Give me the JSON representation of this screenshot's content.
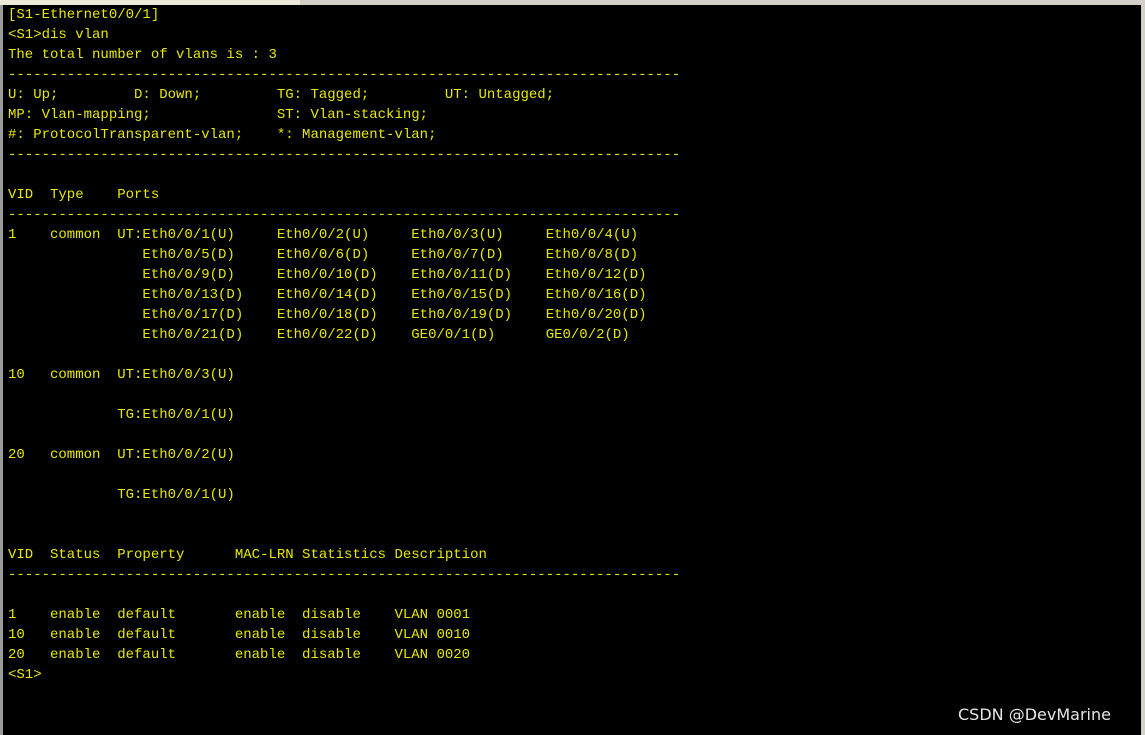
{
  "terminal": {
    "text_color": "#e8e800",
    "background": "#000000",
    "lines": [
      "[S1-Ethernet0/0/1]",
      "<S1>dis vlan",
      "The total number of vlans is : 3",
      "--------------------------------------------------------------------------------",
      "U: Up;         D: Down;         TG: Tagged;         UT: Untagged;",
      "MP: Vlan-mapping;               ST: Vlan-stacking;",
      "#: ProtocolTransparent-vlan;    *: Management-vlan;",
      "--------------------------------------------------------------------------------",
      "",
      "VID  Type    Ports",
      "--------------------------------------------------------------------------------",
      "1    common  UT:Eth0/0/1(U)     Eth0/0/2(U)     Eth0/0/3(U)     Eth0/0/4(U)",
      "                Eth0/0/5(D)     Eth0/0/6(D)     Eth0/0/7(D)     Eth0/0/8(D)",
      "                Eth0/0/9(D)     Eth0/0/10(D)    Eth0/0/11(D)    Eth0/0/12(D)",
      "                Eth0/0/13(D)    Eth0/0/14(D)    Eth0/0/15(D)    Eth0/0/16(D)",
      "                Eth0/0/17(D)    Eth0/0/18(D)    Eth0/0/19(D)    Eth0/0/20(D)",
      "                Eth0/0/21(D)    Eth0/0/22(D)    GE0/0/1(D)      GE0/0/2(D)",
      "",
      "10   common  UT:Eth0/0/3(U)",
      "",
      "             TG:Eth0/0/1(U)",
      "",
      "20   common  UT:Eth0/0/2(U)",
      "",
      "             TG:Eth0/0/1(U)",
      "",
      "",
      "VID  Status  Property      MAC-LRN Statistics Description",
      "--------------------------------------------------------------------------------",
      "",
      "1    enable  default       enable  disable    VLAN 0001",
      "10   enable  default       enable  disable    VLAN 0010",
      "20   enable  default       enable  disable    VLAN 0020",
      "<S1>"
    ]
  },
  "watermark": {
    "text": "CSDN @DevMarine"
  }
}
